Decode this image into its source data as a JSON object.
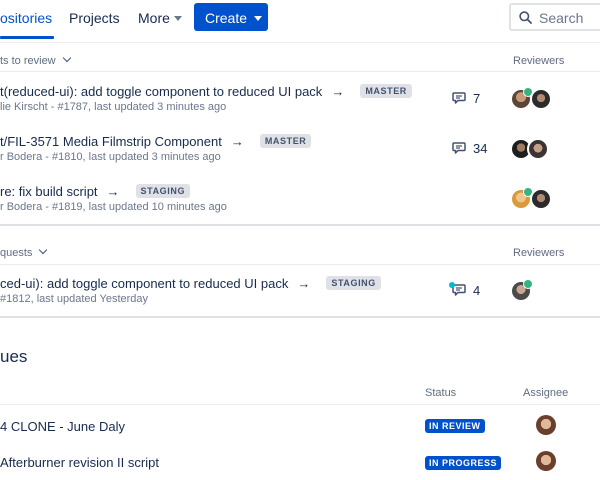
{
  "nav": {
    "repositories": "ositories",
    "projects": "Projects",
    "more": "More",
    "create": "Create",
    "search_placeholder": "Search"
  },
  "reviews_section": {
    "header": "ts to review",
    "reviewers_header": "Reviewers",
    "rows": [
      {
        "title": "t(reduced-ui): add toggle component to reduced UI pack",
        "branch": "MASTER",
        "meta": "lie Kirscht - #1787, last updated  3 minutes ago",
        "comments": "7"
      },
      {
        "title": "t/FIL-3571 Media Filmstrip Component",
        "branch": "MASTER",
        "meta": "r Bodera - #1810, last updated 3 minutes ago",
        "comments": "34"
      },
      {
        "title": "re: fix build script",
        "branch": "STAGING",
        "meta": "r Bodera - #1819, last updated  10 minutes ago",
        "comments": ""
      }
    ]
  },
  "requests_section": {
    "header": "quests",
    "reviewers_header": "Reviewers",
    "rows": [
      {
        "title": "ced-ui): add toggle component to reduced UI pack",
        "branch": "STAGING",
        "meta": "#1812, last updated Yesterday",
        "comments": "4"
      }
    ]
  },
  "issues_section": {
    "title": "ues",
    "status_header": "Status",
    "assignee_header": "Assignee",
    "rows": [
      {
        "text": "4  CLONE - June Daly",
        "status": "IN REVIEW"
      },
      {
        "text": " Afterburner revision II script",
        "status": "IN PROGRESS"
      }
    ]
  },
  "icons": {
    "comment": "comment-icon",
    "search": "search-icon",
    "chevron": "chevron-down-icon",
    "check": "check-icon"
  },
  "colors": {
    "brand": "#0052CC",
    "text": "#172B4D",
    "muted": "#6B778C",
    "lozenge_bg": "#DFE1E6",
    "success": "#36B37E",
    "unread": "#00B8D9"
  }
}
